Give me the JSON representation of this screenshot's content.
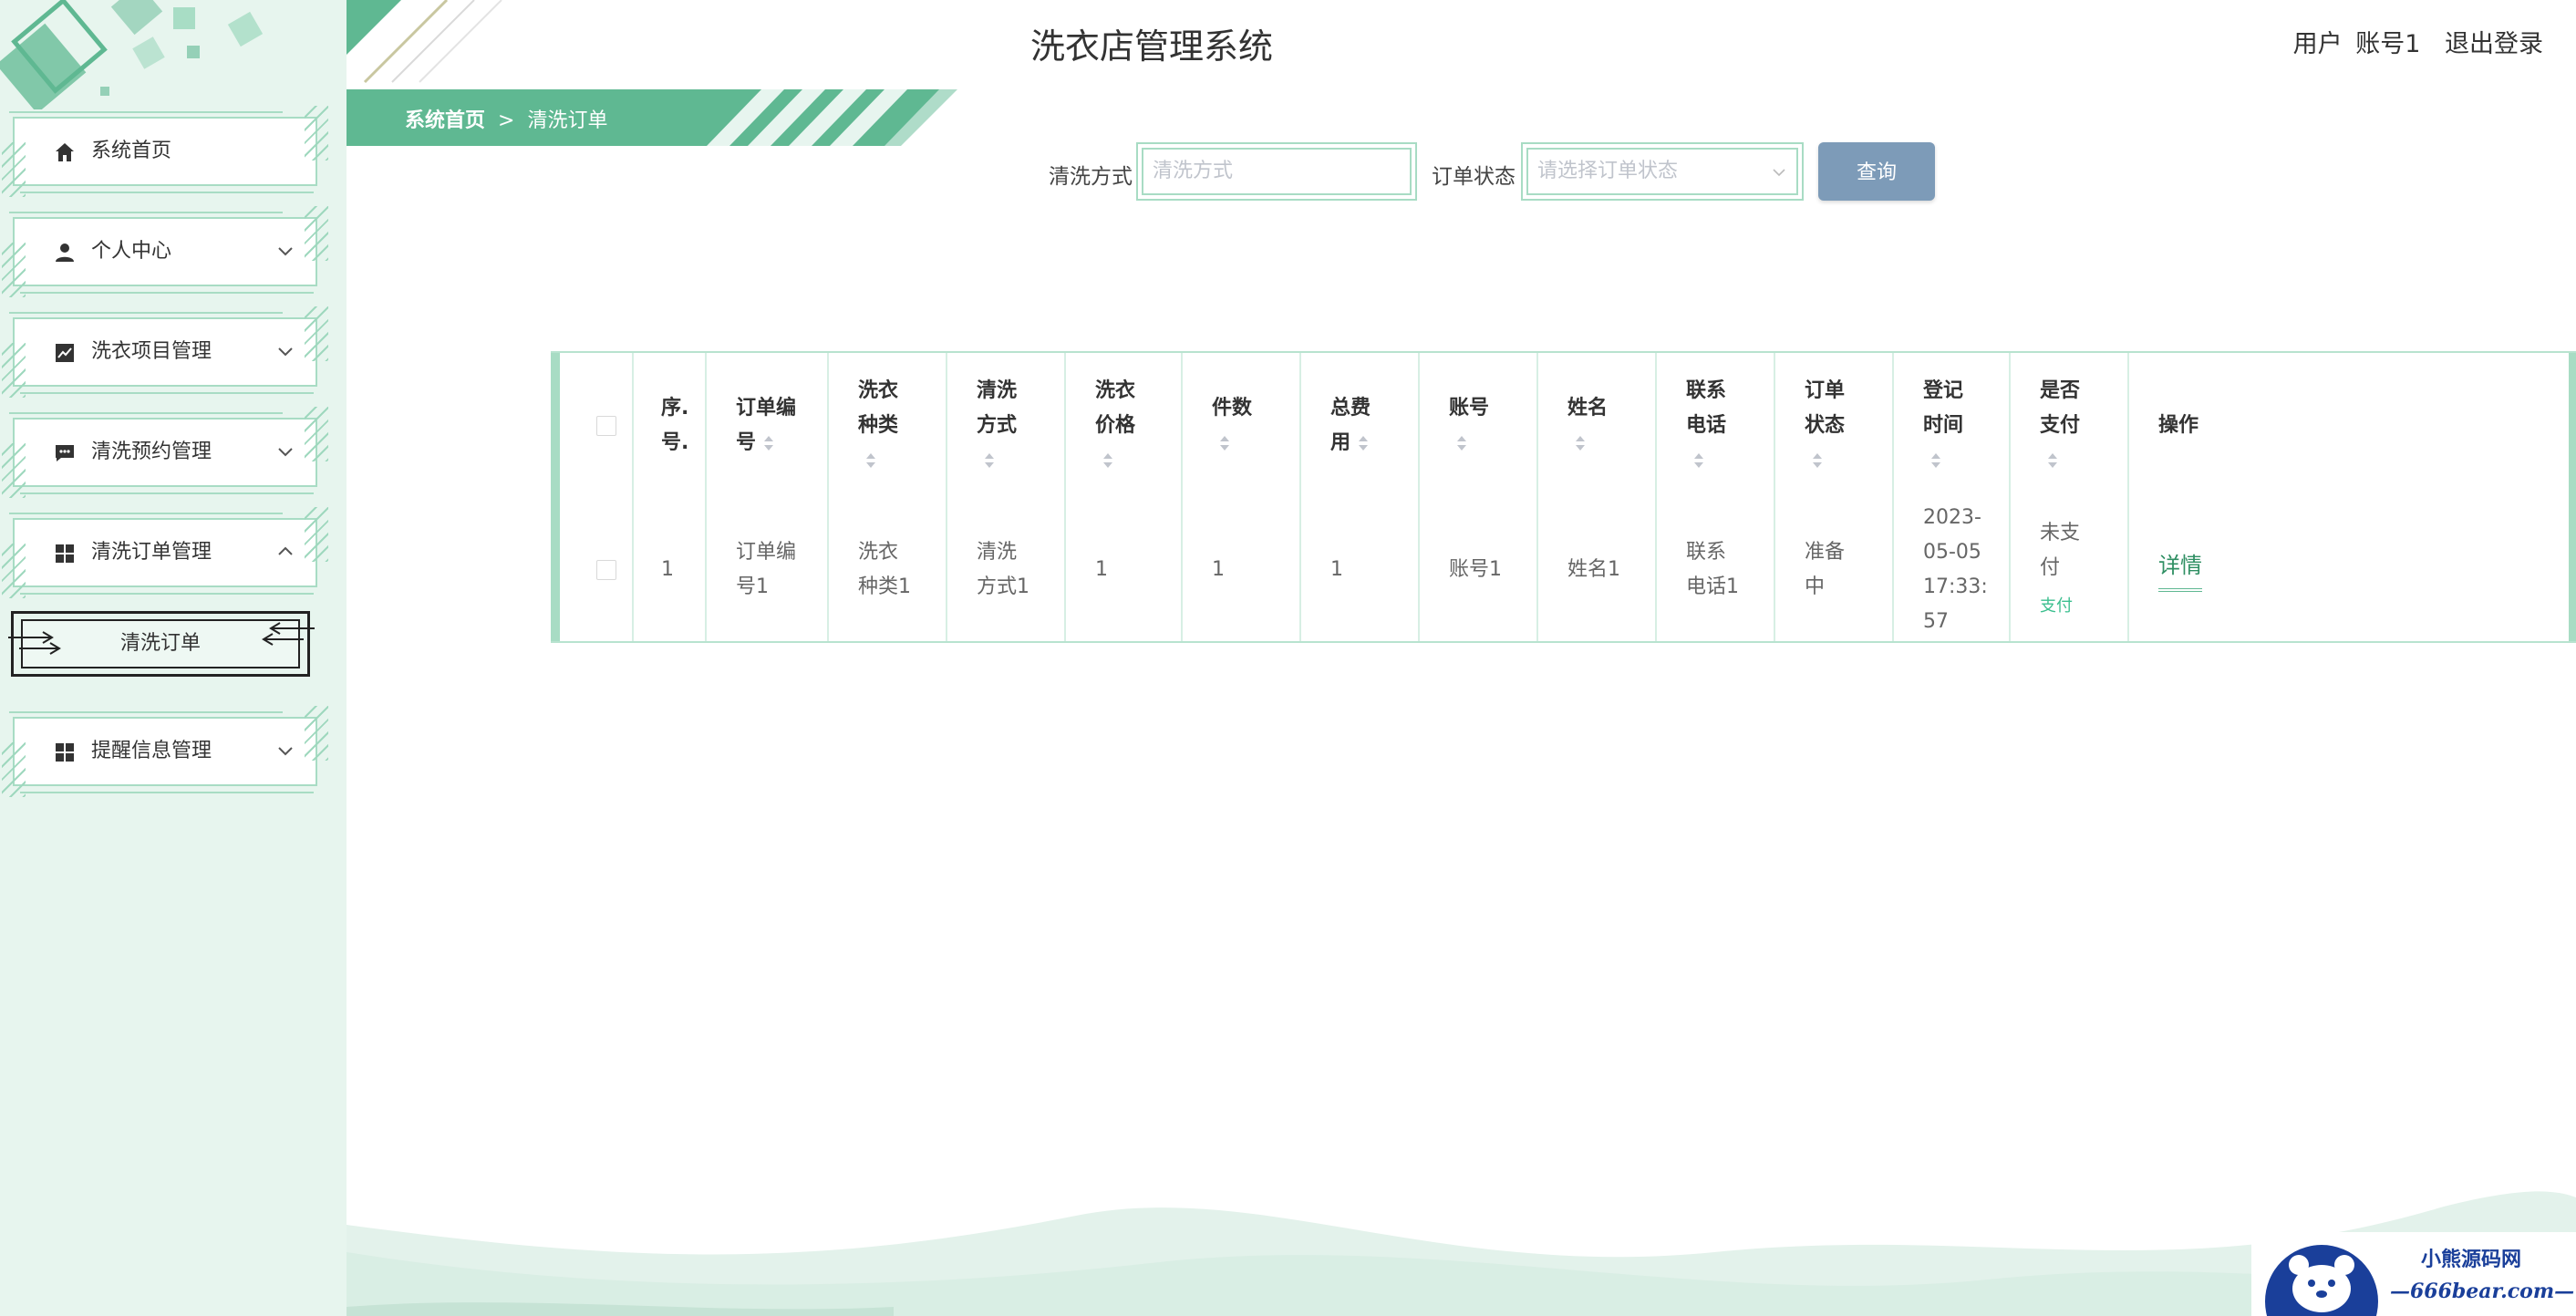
{
  "header": {
    "title": "洗衣店管理系统",
    "user_label": "用户",
    "username": "账号1",
    "logout": "退出登录"
  },
  "breadcrumb": {
    "home": "系统首页",
    "separator": ">",
    "current": "清洗订单"
  },
  "sidebar": {
    "items": [
      {
        "label": "系统首页",
        "icon": "home-icon"
      },
      {
        "label": "个人中心",
        "icon": "user-icon"
      },
      {
        "label": "洗衣项目管理",
        "icon": "chart-icon"
      },
      {
        "label": "清洗预约管理",
        "icon": "chat-icon"
      },
      {
        "label": "清洗订单管理",
        "icon": "grid-icon"
      },
      {
        "label": "提醒信息管理",
        "icon": "grid-icon"
      }
    ],
    "submenu": {
      "label": "清洗订单"
    }
  },
  "search": {
    "method_label": "清洗方式",
    "method_placeholder": "清洗方式",
    "status_label": "订单状态",
    "status_placeholder": "请选择订单状态",
    "query_button": "查询"
  },
  "table": {
    "headers": {
      "index": [
        "序.",
        "号."
      ],
      "order_no": [
        "订单编",
        "号"
      ],
      "type": [
        "洗衣",
        "种类"
      ],
      "method": [
        "清洗",
        "方式"
      ],
      "price": [
        "洗衣",
        "价格"
      ],
      "count": [
        "件数"
      ],
      "total": [
        "总费",
        "用"
      ],
      "account": [
        "账号"
      ],
      "name": [
        "姓名"
      ],
      "phone": [
        "联系",
        "电话"
      ],
      "status": [
        "订单",
        "状态"
      ],
      "time": [
        "登记",
        "时间"
      ],
      "paid": [
        "是否",
        "支付"
      ],
      "action": [
        "操作"
      ]
    },
    "rows": [
      {
        "index": "1",
        "order_no": [
          "订单编",
          "号1"
        ],
        "type": [
          "洗衣",
          "种类1"
        ],
        "method": [
          "清洗",
          "方式1"
        ],
        "price": "1",
        "count": "1",
        "total": "1",
        "account": "账号1",
        "name": "姓名1",
        "phone": [
          "联系",
          "电话1"
        ],
        "status": [
          "准备",
          "中"
        ],
        "time": [
          "2023-",
          "05-05",
          "17:33:",
          "57"
        ],
        "paid": [
          "未支",
          "付"
        ],
        "pay_link": "支付",
        "detail": "详情"
      }
    ]
  },
  "watermark": {
    "line1": "小熊源码网",
    "line2": "—666bear.com—"
  },
  "colors": {
    "accent": "#5fb892",
    "sidebar_bg": "#e7f5ee",
    "border": "#a8dcc4",
    "query_button": "#7d9bb8"
  }
}
